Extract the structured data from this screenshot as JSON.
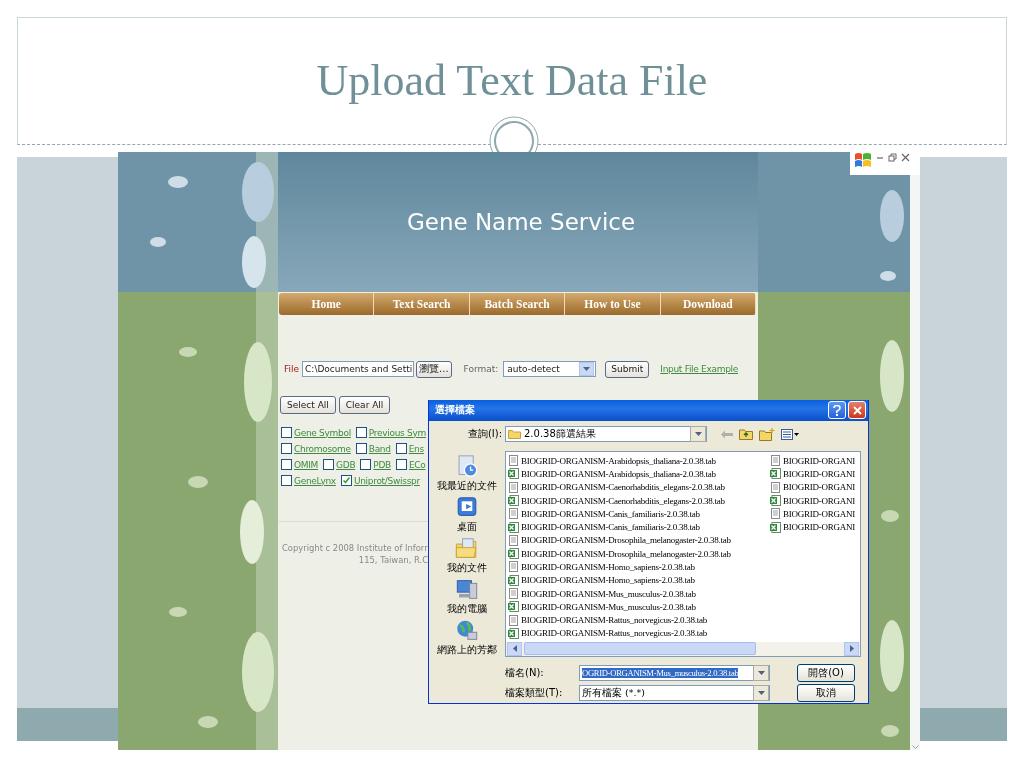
{
  "slide": {
    "title": "Upload Text Data File"
  },
  "site": {
    "title": "Gene Name Service",
    "nav": [
      {
        "label": "Home"
      },
      {
        "label": "Text Search"
      },
      {
        "label": "Batch Search"
      },
      {
        "label": "How to Use"
      },
      {
        "label": "Download"
      }
    ],
    "file_label": "File",
    "file_value": "C:\\Documents and Setti",
    "browse_button": "瀏覽...",
    "format_label": "Format:",
    "format_value": "auto-detect",
    "submit_button": "Submit",
    "example_link": "Input File Example",
    "buttons": [
      "Select All",
      "Clear All"
    ],
    "checkbox_rows": [
      {
        "items": [
          {
            "label": "Gene Symbol",
            "checked": false
          },
          {
            "label": "Previous Sym",
            "checked": false
          }
        ]
      },
      {
        "items": [
          {
            "label": "Chromosome",
            "checked": false
          },
          {
            "label": "Band",
            "checked": false
          },
          {
            "label": "Ens",
            "checked": false
          }
        ]
      },
      {
        "items": [
          {
            "label": "OMIM",
            "checked": false
          },
          {
            "label": "GDB",
            "checked": false
          },
          {
            "label": "PDB",
            "checked": false
          },
          {
            "label": "ECo",
            "checked": false
          }
        ]
      },
      {
        "items": [
          {
            "label": "GeneLynx",
            "checked": false
          },
          {
            "label": "Uniprot/Swisspr",
            "checked": true
          }
        ]
      }
    ],
    "copyright": [
      "Copyright c 2008 Institute of Inforr",
      "115, Taiwan, R.C"
    ]
  },
  "dialog": {
    "title": "選擇檔案",
    "look_in_label": "查詢(I):",
    "look_in_value": "2.0.38篩選結果",
    "places": [
      {
        "label": "我最近的文件",
        "kind": "recent"
      },
      {
        "label": "桌面",
        "kind": "desktop"
      },
      {
        "label": "我的文件",
        "kind": "documents"
      },
      {
        "label": "我的電腦",
        "kind": "computer"
      },
      {
        "label": "網路上的芳鄰",
        "kind": "network"
      }
    ],
    "files_column_1": [
      {
        "name": "BIOGRID-ORGANISM-Arabidopsis_thaliana-2.0.38.tab",
        "kind": "text"
      },
      {
        "name": "BIOGRID-ORGANISM-Arabidopsis_thaliana-2.0.38.tab",
        "kind": "excel"
      },
      {
        "name": "BIOGRID-ORGANISM-Caenorhabditis_elegans-2.0.38.tab",
        "kind": "text"
      },
      {
        "name": "BIOGRID-ORGANISM-Caenorhabditis_elegans-2.0.38.tab",
        "kind": "excel"
      },
      {
        "name": "BIOGRID-ORGANISM-Canis_familiaris-2.0.38.tab",
        "kind": "text"
      },
      {
        "name": "BIOGRID-ORGANISM-Canis_familiaris-2.0.38.tab",
        "kind": "excel"
      },
      {
        "name": "BIOGRID-ORGANISM-Drosophila_melanogaster-2.0.38.tab",
        "kind": "text"
      },
      {
        "name": "BIOGRID-ORGANISM-Drosophila_melanogaster-2.0.38.tab",
        "kind": "excel"
      },
      {
        "name": "BIOGRID-ORGANISM-Homo_sapiens-2.0.38.tab",
        "kind": "text"
      },
      {
        "name": "BIOGRID-ORGANISM-Homo_sapiens-2.0.38.tab",
        "kind": "excel"
      },
      {
        "name": "BIOGRID-ORGANISM-Mus_musculus-2.0.38.tab",
        "kind": "text"
      },
      {
        "name": "BIOGRID-ORGANISM-Mus_musculus-2.0.38.tab",
        "kind": "excel"
      },
      {
        "name": "BIOGRID-ORGANISM-Rattus_norvegicus-2.0.38.tab",
        "kind": "text"
      },
      {
        "name": "BIOGRID-ORGANISM-Rattus_norvegicus-2.0.38.tab",
        "kind": "excel"
      }
    ],
    "files_column_2": [
      {
        "name": "BIOGRID-ORGANI",
        "kind": "text"
      },
      {
        "name": "BIOGRID-ORGANI",
        "kind": "excel"
      },
      {
        "name": "BIOGRID-ORGANI",
        "kind": "text"
      },
      {
        "name": "BIOGRID-ORGANI",
        "kind": "excel"
      },
      {
        "name": "BIOGRID-ORGANI",
        "kind": "text"
      },
      {
        "name": "BIOGRID-ORGANI",
        "kind": "excel"
      }
    ],
    "filename_label": "檔名(N):",
    "filename_value": "OGRID-ORGANISM-Mus_musculus-2.0.38.tab",
    "filetype_label": "檔案類型(T):",
    "filetype_value": "所有檔案 (*.*)",
    "buttons": [
      "開啓(O)",
      "取消"
    ]
  }
}
